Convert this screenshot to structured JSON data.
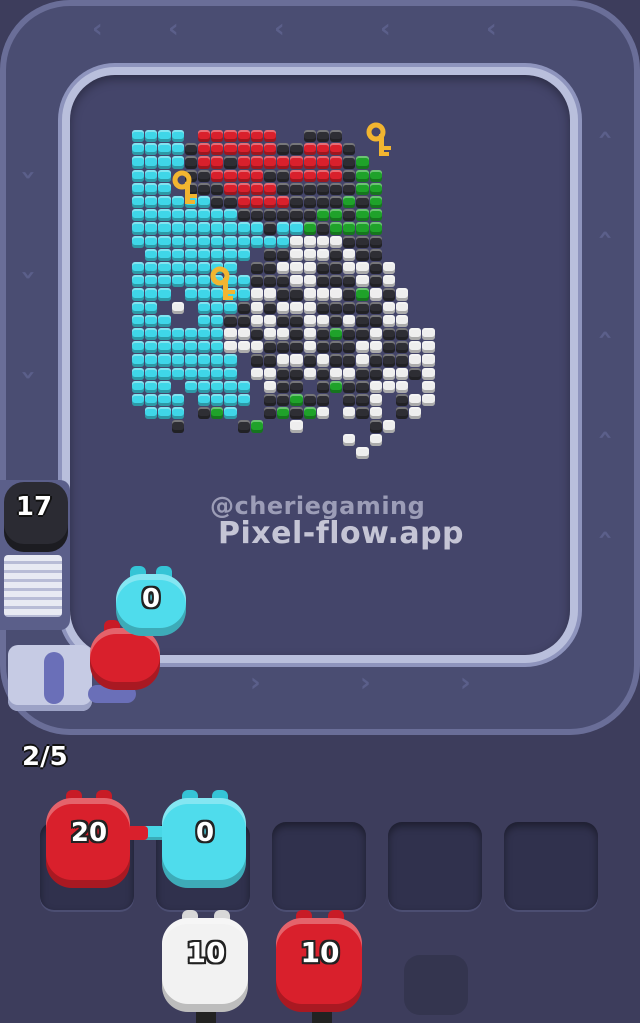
{
  "watermark": {
    "handle": "@cheriegaming",
    "site": "Pixel-flow.app"
  },
  "shooters": {
    "queue_counter": "17",
    "on_belt": [
      {
        "color": "cyan",
        "count": "0"
      },
      {
        "color": "red",
        "count": ""
      }
    ]
  },
  "slots": {
    "used_label": "2/5",
    "occupied": [
      {
        "color": "red",
        "count": "20"
      },
      {
        "color": "cyan",
        "count": "0"
      }
    ]
  },
  "deck": [
    {
      "color": "white",
      "count": "10"
    },
    {
      "color": "red",
      "count": "10"
    }
  ],
  "colors": {
    "cyan": "#3fd6e8",
    "red": "#d9202c",
    "white": "#eeeeee",
    "black": "#2e2e34",
    "green": "#1fa22a",
    "key": "#f2b530"
  },
  "icons": [
    "key-icon",
    "key-icon",
    "key-icon",
    "chevron-icon"
  ]
}
